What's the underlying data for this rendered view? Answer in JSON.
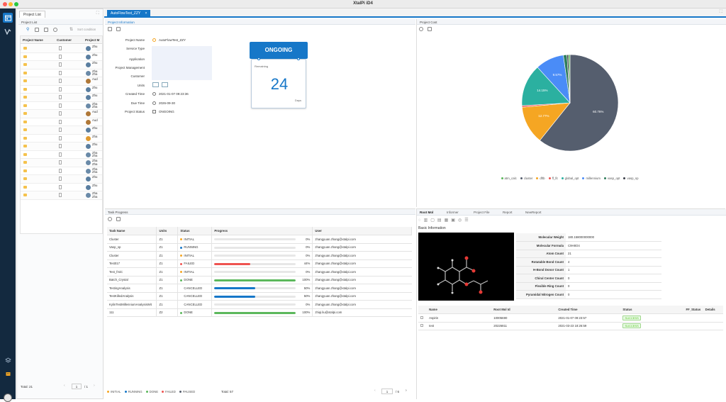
{
  "app": {
    "title": "XtalPi iD4"
  },
  "left_panel": {
    "tab_label": "Project List",
    "section_label": "Project List",
    "search_placeholder": "Sort condition",
    "columns": [
      "Project Name",
      "Customer",
      "Project M"
    ],
    "rows": [
      "Zhu",
      "Zhu",
      "Zhu",
      "Zha\nZha",
      "Aud",
      "Zhu",
      "Zhu",
      "Zha\nZha",
      "Aud",
      "Aud",
      "Zhu",
      "Zha",
      "Zhu",
      "Zha\nZha",
      "Zha\nZha",
      "Zha\nZha",
      "Zhu",
      "Zhu",
      "Zha\nZha"
    ],
    "total": "Total: 21",
    "page_current": "1",
    "page_total": "/ 1"
  },
  "main_tab": {
    "label": "AutoFlowTest_ZZY"
  },
  "project_info": {
    "header": "Project Information",
    "fields": [
      {
        "label": "Project Name",
        "value": "AutoFlowTest_ZZY"
      },
      {
        "label": "Service Type",
        "value": ""
      },
      {
        "label": "Application",
        "value": ""
      },
      {
        "label": "Project Management",
        "value": ""
      },
      {
        "label": "Customer",
        "value": ""
      },
      {
        "label": "Units",
        "value": ""
      },
      {
        "label": "Created Time",
        "value": "2021-01-07 09:23:36"
      },
      {
        "label": "Due Time",
        "value": "2026-09-30"
      },
      {
        "label": "Project Status",
        "value": "ONGOING"
      }
    ],
    "status_card": {
      "title": "ONGOING",
      "remaining_label": "Remaining",
      "days": "24",
      "days_unit": "Days"
    }
  },
  "project_cost": {
    "header": "Project Cost",
    "legend": [
      {
        "name": "atm_calc",
        "color": "#5cb85c"
      },
      {
        "name": "cluster",
        "color": "#555e6e"
      },
      {
        "name": "dftb",
        "color": "#f5a623"
      },
      {
        "name": "ff_fit",
        "color": "#ef5350"
      },
      {
        "name": "global_opt",
        "color": "#2bb0a0"
      },
      {
        "name": "millennium",
        "color": "#4a8cf7"
      },
      {
        "name": "vasp_opt",
        "color": "#2e7d5b"
      },
      {
        "name": "vasp_sp",
        "color": "#3b3f49"
      }
    ]
  },
  "chart_data": {
    "type": "pie",
    "title": "",
    "slices": [
      {
        "name": "cluster",
        "value": 60.76,
        "label": "60.76%",
        "color": "#555e6e"
      },
      {
        "name": "dftb",
        "value": 12.77,
        "label": "12.77%",
        "color": "#f5a623"
      },
      {
        "name": "ff_fit",
        "value": 0.52,
        "label": "0.52%",
        "color": "#ef5350"
      },
      {
        "name": "global_opt",
        "value": 14.15,
        "label": "14.15%",
        "color": "#2bb0a0"
      },
      {
        "name": "millennium",
        "value": 9.57,
        "label": "9.57%",
        "color": "#4a8cf7"
      },
      {
        "name": "vasp_opt",
        "value": 1.19,
        "label": "1.19%",
        "color": "#2e7d5b"
      },
      {
        "name": "vasp_sp",
        "value": 0.52,
        "label": "0.52%",
        "color": "#3b3f49"
      },
      {
        "name": "atm_calc",
        "value": 0.52,
        "label": "0.52%",
        "color": "#5cb85c"
      }
    ]
  },
  "task_progress": {
    "header": "Task Progress",
    "columns": [
      "Task Name",
      "Units",
      "Status",
      "Progress",
      "User"
    ],
    "rows": [
      {
        "name": "Cluster",
        "units": "Z1",
        "status": "INITIAL",
        "status_color": "#f5a623",
        "progress": 0,
        "progress_label": "0%",
        "bar_color": "#d8d8d8",
        "user": "zhangyuan.zhang@xtalpi.com"
      },
      {
        "name": "Vasp_sp",
        "units": "Z1",
        "status": "RUNNING",
        "status_color": "#1677c8",
        "progress": 0,
        "progress_label": "0%",
        "bar_color": "#d8d8d8",
        "user": "zhangyuan.zhang@xtalpi.com"
      },
      {
        "name": "Cluster",
        "units": "Z1",
        "status": "INITIAL",
        "status_color": "#f5a623",
        "progress": 0,
        "progress_label": "0%",
        "bar_color": "#d8d8d8",
        "user": "zhangyuan.zhang@xtalpi.com"
      },
      {
        "name": "Test017",
        "units": "Z1",
        "status": "FAILED",
        "status_color": "#ef5350",
        "progress": 44,
        "progress_label": "44%",
        "bar_color": "#ef5350",
        "user": "zhangyuan.zhang@xtalpi.com"
      },
      {
        "name": "Test_fmiC",
        "units": "Z1",
        "status": "INITIAL",
        "status_color": "#f5a623",
        "progress": 0,
        "progress_label": "0%",
        "bar_color": "#d8d8d8",
        "user": "zhangyuan.zhang@xtalpi.com"
      },
      {
        "name": "Batch_Crystal",
        "units": "Z1",
        "status": "DONE",
        "status_color": "#5cb85c",
        "progress": 100,
        "progress_label": "100%",
        "bar_color": "#5cb85c",
        "user": "zhangyuan.zhang@xtalpi.com"
      },
      {
        "name": "TestingAnalysis",
        "units": "Z1",
        "status": "CANCELLED",
        "status_color": "",
        "progress": 50,
        "progress_label": "50%",
        "bar_color": "#1677c8",
        "user": "zhangyuan.zhang@xtalpi.com"
      },
      {
        "name": "TestKilledAnalysis",
        "units": "Z1",
        "status": "CANCELLED",
        "status_color": "",
        "progress": 50,
        "progress_label": "50%",
        "bar_color": "#1677c8",
        "user": "zhangyuan.zhang@xtalpi.com"
      },
      {
        "name": "KylinTestMillenniumAnalysisWit",
        "units": "Z1",
        "status": "CANCELLED",
        "status_color": "",
        "progress": 0,
        "progress_label": "0%",
        "bar_color": "#d8d8d8",
        "user": "zhangyuan.zhang@xtalpi.com"
      },
      {
        "name": "111",
        "units": "Z2",
        "status": "DONE",
        "status_color": "#5cb85c",
        "progress": 100,
        "progress_label": "100%",
        "bar_color": "#5cb85c",
        "user": "zhiqi.liu@xtalpi.com"
      }
    ],
    "footer_legend": [
      {
        "name": "INITIAL",
        "color": "#f5a623"
      },
      {
        "name": "RUNNING",
        "color": "#1677c8"
      },
      {
        "name": "DONE",
        "color": "#5cb85c"
      },
      {
        "name": "FAILED",
        "color": "#ef5350"
      },
      {
        "name": "PAUSED",
        "color": "#555e6e"
      }
    ],
    "total": "Total: 57",
    "page_current": "1",
    "page_total": "/ 6"
  },
  "root_mol": {
    "tabs": [
      "Root Mol",
      "Informer",
      "Project File",
      "Report",
      "NewReport"
    ],
    "basic_info_title": "Basic Information",
    "properties": [
      {
        "label": "Molecular Weight",
        "value": "180.158000000000"
      },
      {
        "label": "Molecular Formula",
        "value": "C9H8O4"
      },
      {
        "label": "Atom Count",
        "value": "21"
      },
      {
        "label": "Rotatable Bond Count",
        "value": "4"
      },
      {
        "label": "H-Bond Donor Count",
        "value": "1"
      },
      {
        "label": "Chiral Center Count",
        "value": "0"
      },
      {
        "label": "Flexible Ring Count",
        "value": "0"
      },
      {
        "label": "Pyramidal Nitrogen Count",
        "value": "0"
      }
    ],
    "columns": [
      "Name",
      "Root Mol Id",
      "Created Time",
      "Status",
      "FF_Status",
      "Details"
    ],
    "rows": [
      {
        "name": "Aspirin",
        "id": "10005690",
        "created": "2021-01-07 09:23:57",
        "status": "SUCCESS"
      },
      {
        "name": "test",
        "id": "20226811",
        "created": "2021-03-23 18:26:59",
        "status": "SUCCESS"
      }
    ]
  }
}
